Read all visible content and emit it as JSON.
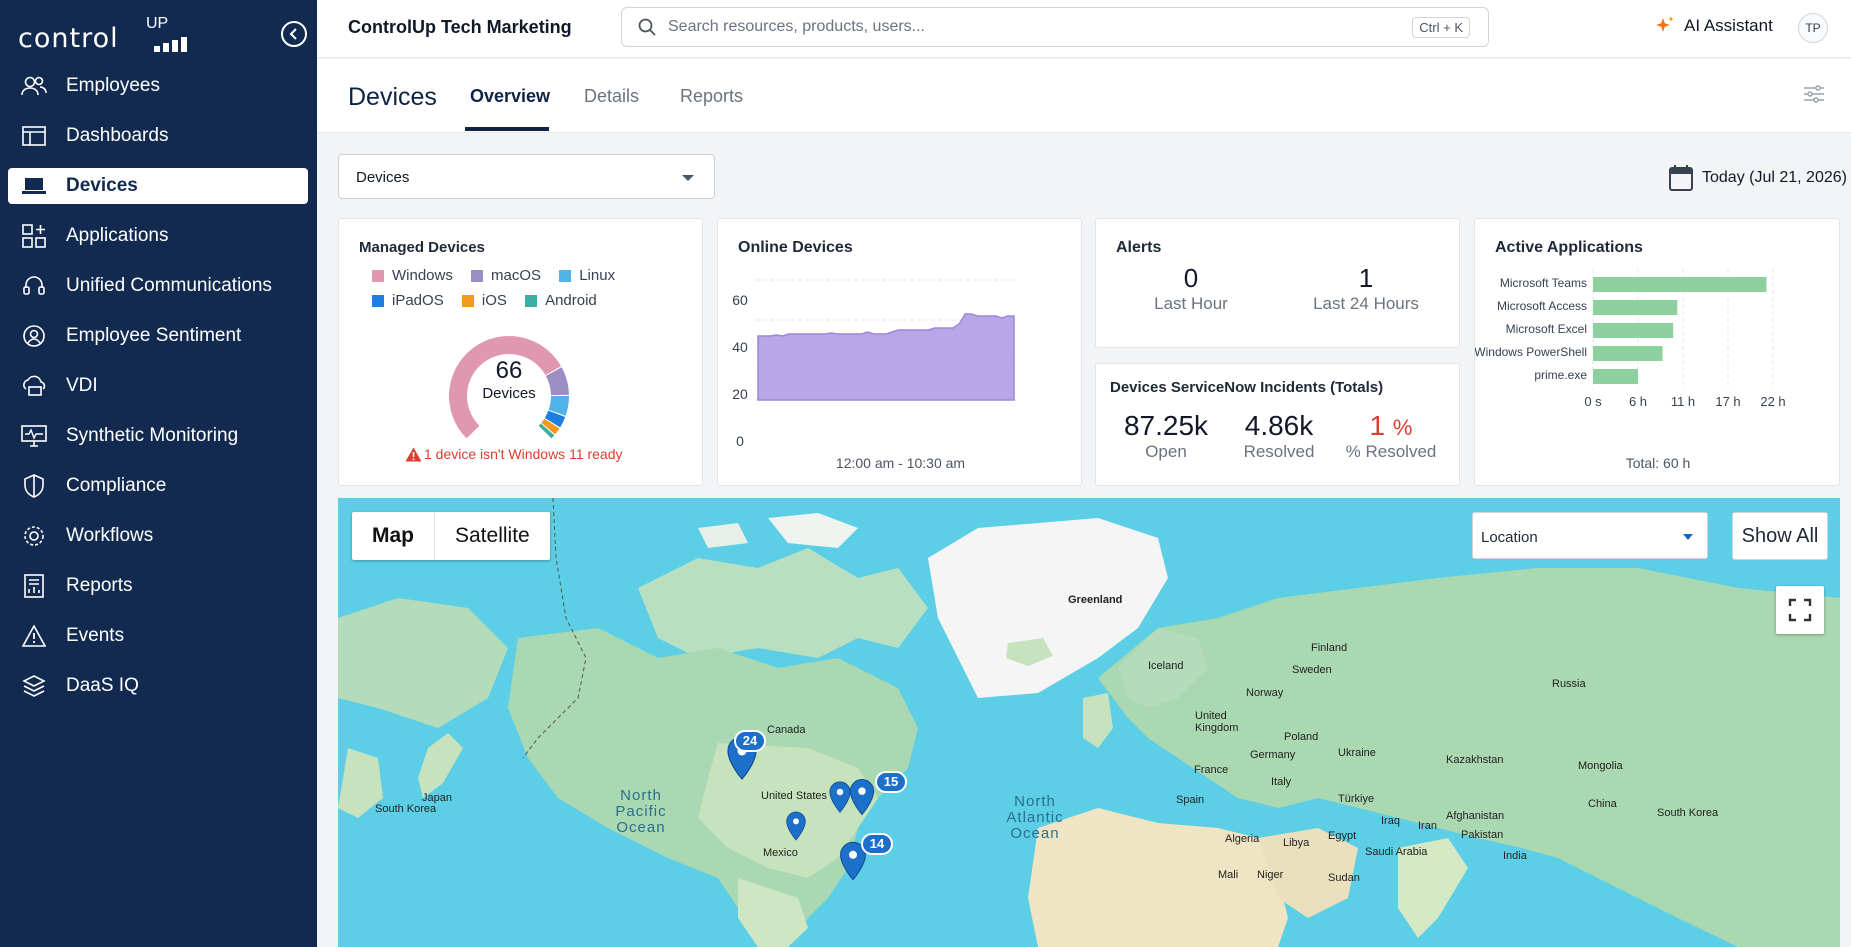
{
  "sidebar": {
    "logo_text": "control",
    "logo_sup": "UP",
    "items": [
      {
        "label": "Employees",
        "icon": "users-icon"
      },
      {
        "label": "Dashboards",
        "icon": "dashboard-icon"
      },
      {
        "label": "Devices",
        "icon": "laptop-icon",
        "active": true
      },
      {
        "label": "Applications",
        "icon": "apps-icon"
      },
      {
        "label": "Unified Communications",
        "icon": "headset-icon"
      },
      {
        "label": "Employee Sentiment",
        "icon": "sentiment-icon"
      },
      {
        "label": "VDI",
        "icon": "vdi-icon"
      },
      {
        "label": "Synthetic Monitoring",
        "icon": "monitor-icon"
      },
      {
        "label": "Compliance",
        "icon": "shield-icon"
      },
      {
        "label": "Workflows",
        "icon": "workflow-icon"
      },
      {
        "label": "Reports",
        "icon": "report-icon"
      },
      {
        "label": "Events",
        "icon": "warning-icon"
      },
      {
        "label": "DaaS IQ",
        "icon": "layers-icon"
      }
    ]
  },
  "topbar": {
    "org": "ControlUp Tech Marketing",
    "search_placeholder": "Search resources, products, users...",
    "shortcut": "Ctrl + K",
    "ai_label": "AI Assistant",
    "avatar": "TP"
  },
  "page": {
    "title": "Devices",
    "tabs": [
      "Overview",
      "Details",
      "Reports"
    ],
    "device_select": "Devices",
    "date": "Today (Jul 21, 2026)"
  },
  "managed": {
    "title": "Managed Devices",
    "legend": [
      {
        "name": "Windows",
        "color": "#e098b0"
      },
      {
        "name": "macOS",
        "color": "#9b8ec4"
      },
      {
        "name": "Linux",
        "color": "#4fb4ea"
      },
      {
        "name": "iPadOS",
        "color": "#1e7fe0"
      },
      {
        "name": "iOS",
        "color": "#f39a1e"
      },
      {
        "name": "Android",
        "color": "#3aaea0"
      }
    ],
    "total": "66",
    "total_label": "Devices",
    "warning": "1 device isn't Windows 11 ready"
  },
  "online": {
    "title": "Online Devices",
    "yticks": [
      "60",
      "40",
      "20",
      "0"
    ],
    "xlabel": "12:00 am - 10:30 am"
  },
  "alerts": {
    "title": "Alerts",
    "items": [
      {
        "value": "0",
        "label": "Last Hour"
      },
      {
        "value": "1",
        "label": "Last 24 Hours"
      }
    ]
  },
  "servicenow": {
    "title": "Devices ServiceNow Incidents (Totals)",
    "open": "87.25k",
    "open_label": "Open",
    "resolved": "4.86k",
    "resolved_label": "Resolved",
    "pct": "1",
    "pct_sign": "%",
    "pct_label": "% Resolved"
  },
  "apps": {
    "title": "Active Applications",
    "xticks": [
      "0 s",
      "6 h",
      "11 h",
      "17 h",
      "22 h"
    ],
    "total": "Total: 60 h"
  },
  "chart_data": [
    {
      "type": "pie",
      "title": "Managed Devices",
      "categories": [
        "Windows",
        "macOS",
        "Linux",
        "iPadOS",
        "iOS",
        "Android"
      ],
      "values": [
        48,
        7,
        5,
        3,
        2,
        1
      ]
    },
    {
      "type": "area",
      "title": "Online Devices",
      "ylim": [
        0,
        60
      ],
      "xlabel": "12:00 am - 10:30 am",
      "values": [
        32,
        32,
        32,
        32.5,
        32,
        33,
        33,
        33,
        33,
        33,
        33,
        33,
        33.5,
        33,
        33,
        33,
        33,
        33,
        34,
        33,
        33,
        33,
        34,
        35,
        35,
        35,
        35,
        35,
        35,
        36,
        36,
        36,
        36,
        38,
        43,
        43,
        42,
        42,
        42,
        42,
        41,
        42,
        42
      ]
    },
    {
      "type": "bar",
      "title": "Active Applications",
      "categories": [
        "Microsoft Teams",
        "Microsoft Access",
        "Microsoft Excel",
        "Windows PowerShell",
        "prime.exe"
      ],
      "values": [
        21.2,
        10.3,
        9.8,
        8.5,
        5.5
      ],
      "xlim": [
        0,
        22
      ]
    }
  ],
  "map": {
    "toggle": [
      "Map",
      "Satellite"
    ],
    "location_select": "Location",
    "show_all": "Show All",
    "clusters": [
      "24",
      "15",
      "14"
    ],
    "places": [
      "Greenland",
      "Iceland",
      "Finland",
      "Sweden",
      "Norway",
      "Russia",
      "United Kingdom",
      "Poland",
      "Germany",
      "Ukraine",
      "France",
      "Kazakhstan",
      "Mongolia",
      "Spain",
      "Italy",
      "Türkiye",
      "China",
      "Iraq",
      "Iran",
      "Afghanistan",
      "Pakistan",
      "South Korea",
      "Japan",
      "South Korea",
      "Canada",
      "United States",
      "Mexico",
      "Algeria",
      "Libya",
      "Egypt",
      "Saudi Arabia",
      "India",
      "Mali",
      "Niger",
      "Sudan"
    ],
    "oceans": [
      "North Pacific Ocean",
      "North Atlantic Ocean"
    ]
  }
}
